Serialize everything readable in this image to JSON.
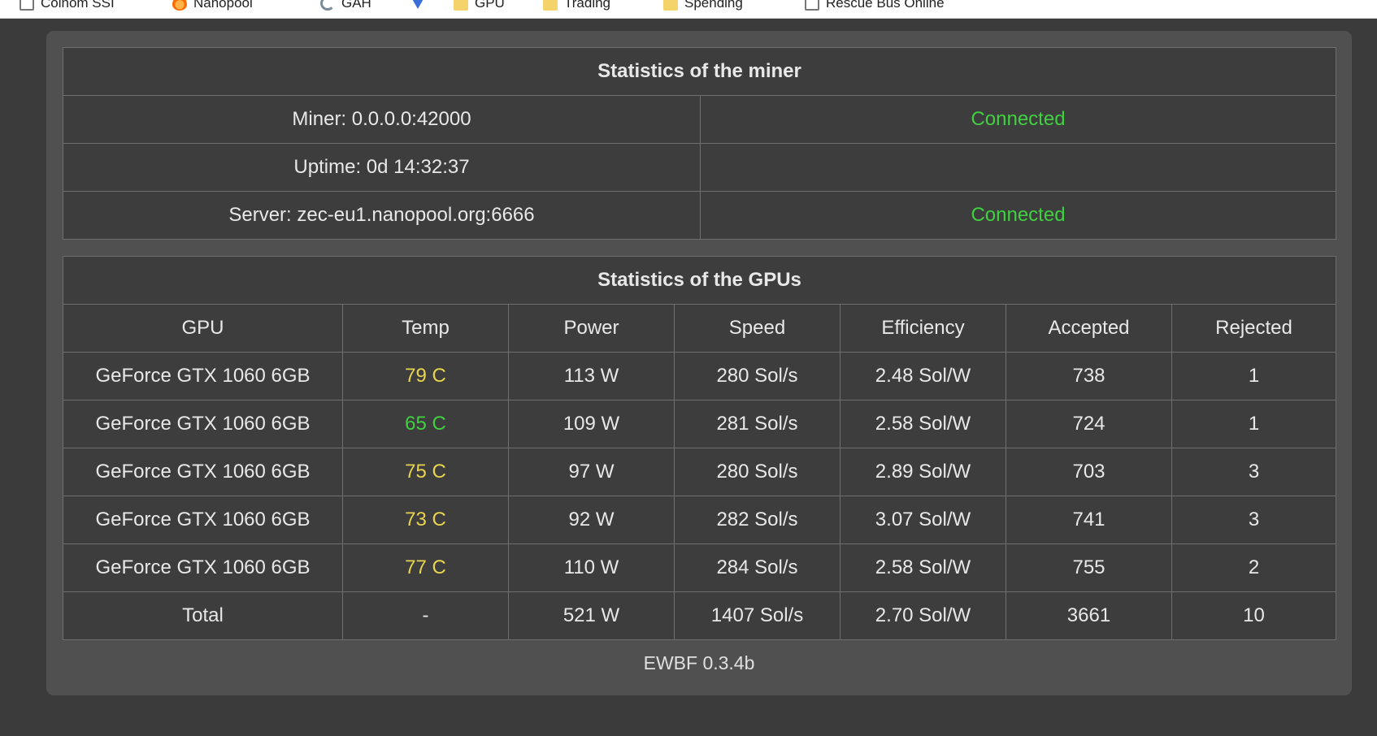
{
  "bookmarks": [
    {
      "icon": "page-icon",
      "label": "Coinom SSI"
    },
    {
      "icon": "fire-icon",
      "label": "Nanopool"
    },
    {
      "icon": "sync-icon",
      "label": "GAH"
    },
    {
      "icon": "arrow-icon",
      "label": ""
    },
    {
      "icon": "folder-icon",
      "label": "GPU"
    },
    {
      "icon": "folder-icon",
      "label": "Trading"
    },
    {
      "icon": "folder-icon",
      "label": "Spending"
    },
    {
      "icon": "page-icon",
      "label": "Rescue Bus Online"
    }
  ],
  "miner_stats": {
    "title": "Statistics of the miner",
    "miner_label": "Miner: 0.0.0.0:42000",
    "miner_status": "Connected",
    "uptime_label": "Uptime: 0d 14:32:37",
    "uptime_status": "",
    "server_label": "Server: zec-eu1.nanopool.org:6666",
    "server_status": "Connected"
  },
  "gpu_stats": {
    "title": "Statistics of the GPUs",
    "columns": [
      "GPU",
      "Temp",
      "Power",
      "Speed",
      "Efficiency",
      "Accepted",
      "Rejected"
    ],
    "rows": [
      {
        "gpu": "GeForce GTX 1060 6GB",
        "temp": "79 C",
        "temp_color": "#e8d44d",
        "power": "113 W",
        "speed": "280 Sol/s",
        "efficiency": "2.48 Sol/W",
        "accepted": "738",
        "rejected": "1"
      },
      {
        "gpu": "GeForce GTX 1060 6GB",
        "temp": "65 C",
        "temp_color": "#3fd13f",
        "power": "109 W",
        "speed": "281 Sol/s",
        "efficiency": "2.58 Sol/W",
        "accepted": "724",
        "rejected": "1"
      },
      {
        "gpu": "GeForce GTX 1060 6GB",
        "temp": "75 C",
        "temp_color": "#e8d44d",
        "power": "97 W",
        "speed": "280 Sol/s",
        "efficiency": "2.89 Sol/W",
        "accepted": "703",
        "rejected": "3"
      },
      {
        "gpu": "GeForce GTX 1060 6GB",
        "temp": "73 C",
        "temp_color": "#e8d44d",
        "power": "92 W",
        "speed": "282 Sol/s",
        "efficiency": "3.07 Sol/W",
        "accepted": "741",
        "rejected": "3"
      },
      {
        "gpu": "GeForce GTX 1060 6GB",
        "temp": "77 C",
        "temp_color": "#e8d44d",
        "power": "110 W",
        "speed": "284 Sol/s",
        "efficiency": "2.58 Sol/W",
        "accepted": "755",
        "rejected": "2"
      }
    ],
    "total": {
      "gpu": "Total",
      "temp": "-",
      "power": "521 W",
      "speed": "1407 Sol/s",
      "efficiency": "2.70 Sol/W",
      "accepted": "3661",
      "rejected": "10"
    }
  },
  "footer": {
    "version": "EWBF 0.3.4b"
  },
  "colors": {
    "connected": "#3fd13f",
    "warm": "#e8d44d",
    "background": "#3b3b3b",
    "panel": "#505050"
  }
}
